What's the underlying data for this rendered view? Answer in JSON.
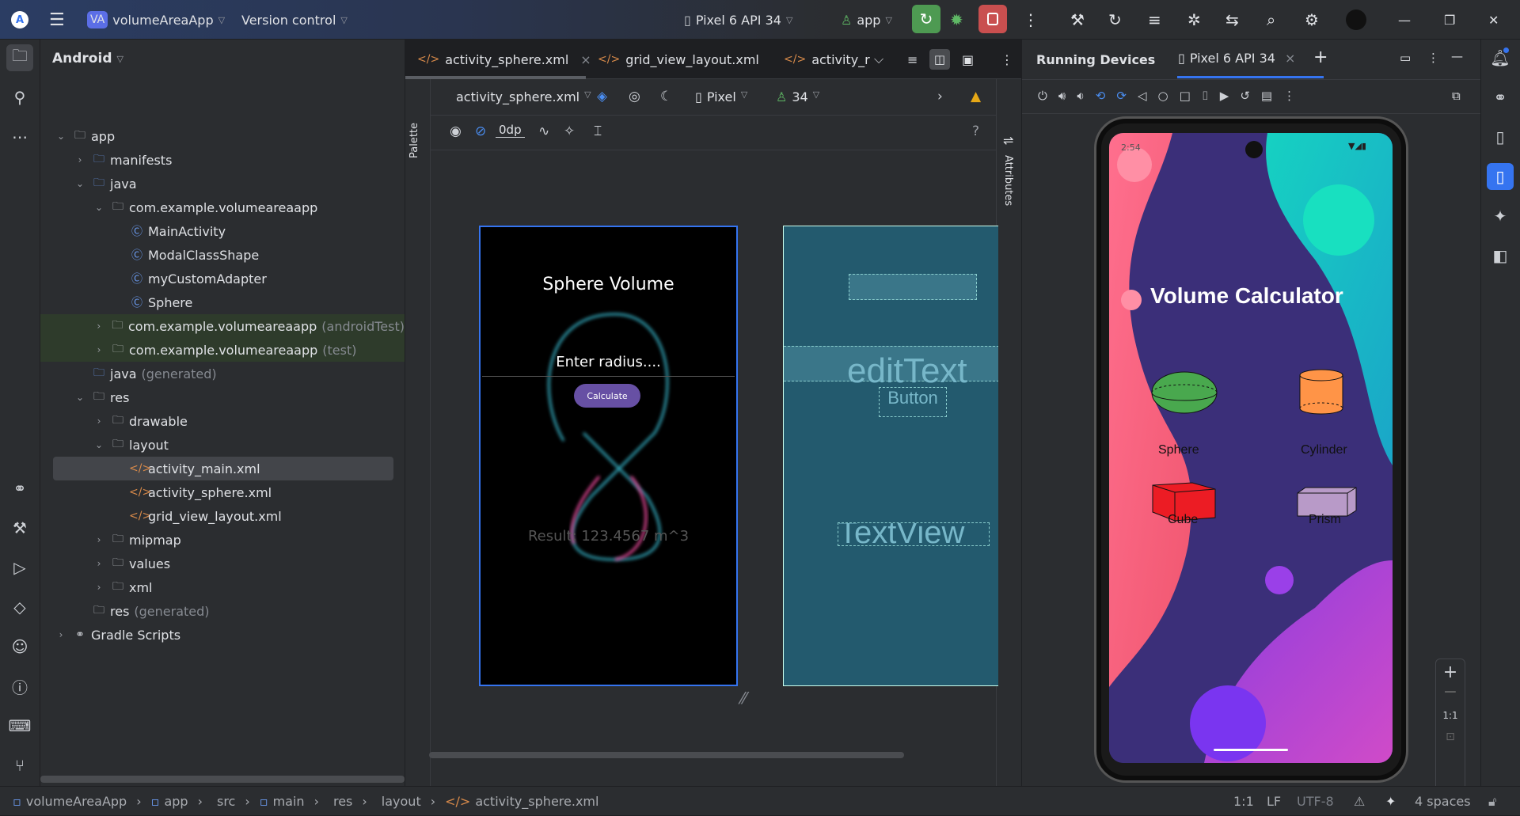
{
  "titlebar": {
    "project_badge": "VA",
    "project_name": "volumeAreaApp",
    "vcs": "Version control",
    "device": "Pixel 6 API 34",
    "run_config": "app"
  },
  "project_panel": {
    "view": "Android",
    "tree": [
      {
        "label": "app",
        "depth": 0,
        "tw": "v",
        "icon": "module"
      },
      {
        "label": "manifests",
        "depth": 1,
        "tw": ">",
        "icon": "folder"
      },
      {
        "label": "java",
        "depth": 1,
        "tw": "v",
        "icon": "folder"
      },
      {
        "label": "com.example.volumeareaapp",
        "depth": 2,
        "tw": "v",
        "icon": "package"
      },
      {
        "label": "MainActivity",
        "depth": 3,
        "tw": "",
        "icon": "class"
      },
      {
        "label": "ModalClassShape",
        "depth": 3,
        "tw": "",
        "icon": "class"
      },
      {
        "label": "myCustomAdapter",
        "depth": 3,
        "tw": "",
        "icon": "class"
      },
      {
        "label": "Sphere",
        "depth": 3,
        "tw": "",
        "icon": "class"
      },
      {
        "label": "com.example.volumeareaapp",
        "suffix": "(androidTest)",
        "depth": 2,
        "tw": ">",
        "icon": "package",
        "green": true
      },
      {
        "label": "com.example.volumeareaapp",
        "suffix": "(test)",
        "depth": 2,
        "tw": ">",
        "icon": "package",
        "green": true
      },
      {
        "label": "java",
        "suffix": "(generated)",
        "depth": 1,
        "tw": "",
        "icon": "folder-gen"
      },
      {
        "label": "res",
        "depth": 1,
        "tw": "v",
        "icon": "folder-res"
      },
      {
        "label": "drawable",
        "depth": 2,
        "tw": ">",
        "icon": "package"
      },
      {
        "label": "layout",
        "depth": 2,
        "tw": "v",
        "icon": "package"
      },
      {
        "label": "activity_main.xml",
        "depth": 3,
        "tw": "",
        "icon": "xml",
        "selected": true
      },
      {
        "label": "activity_sphere.xml",
        "depth": 3,
        "tw": "",
        "icon": "xml"
      },
      {
        "label": "grid_view_layout.xml",
        "depth": 3,
        "tw": "",
        "icon": "xml"
      },
      {
        "label": "mipmap",
        "depth": 2,
        "tw": ">",
        "icon": "package"
      },
      {
        "label": "values",
        "depth": 2,
        "tw": ">",
        "icon": "package"
      },
      {
        "label": "xml",
        "depth": 2,
        "tw": ">",
        "icon": "package"
      },
      {
        "label": "res",
        "suffix": "(generated)",
        "depth": 1,
        "tw": "",
        "icon": "folder-res"
      },
      {
        "label": "Gradle Scripts",
        "depth": 0,
        "tw": ">",
        "icon": "gradle"
      }
    ]
  },
  "editor": {
    "tabs": [
      "activity_sphere.xml",
      "grid_view_layout.xml",
      "activity_r"
    ],
    "toolbar": {
      "file": "activity_sphere.xml",
      "device": "Pixel",
      "api": "34",
      "margin": "0dp",
      "help": "?"
    },
    "palette": "Palette",
    "attributes": "Attributes",
    "preview": {
      "title": "Sphere Volume",
      "hint": "Enter radius....",
      "button": "Calculate",
      "result": "Result: 123.4567 m^3"
    },
    "blueprint": {
      "edit": "editText",
      "button": "Button",
      "text": "TextView"
    }
  },
  "running": {
    "title": "Running Devices",
    "tab": "Pixel 6 API 34",
    "zoom_label": "1:1",
    "phone": {
      "time": "2:54",
      "heading": "Volume Calculator",
      "shapes": [
        "Sphere",
        "Cylinder",
        "Cube",
        "Prism"
      ]
    }
  },
  "statusbar": {
    "crumbs": [
      "volumeAreaApp",
      "app",
      "src",
      "main",
      "res",
      "layout",
      "activity_sphere.xml"
    ],
    "position": "1:1",
    "line_sep": "LF",
    "encoding": "UTF-8",
    "indent": "4 spaces"
  },
  "colors": {
    "accent": "#3574f0",
    "run": "#4e9a52",
    "stop": "#c94f4f",
    "button": "#6750a4",
    "blueprint": "#235a6e"
  }
}
